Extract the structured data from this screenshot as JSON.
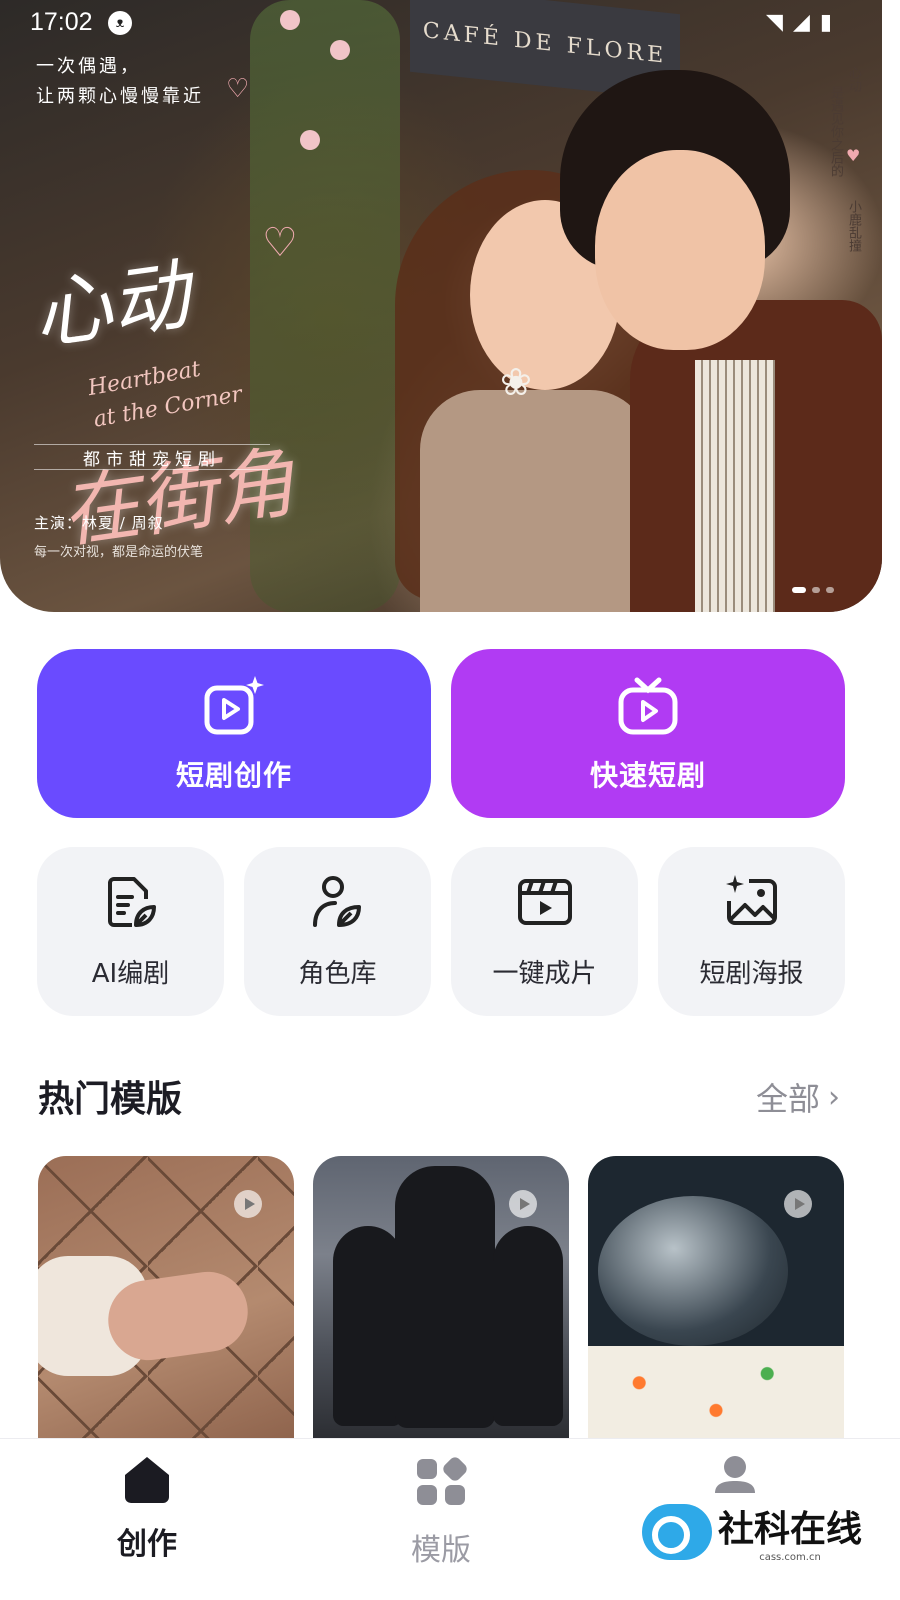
{
  "status_bar": {
    "time": "17:02"
  },
  "banner": {
    "shop_sign": "CAFÉ DE FLORE",
    "tagline": "一次偶遇，\n让两颗心慢慢靠近",
    "title_line1": "心动",
    "title_line2": "在街角",
    "title_en": "Heartbeat\nat the Corner",
    "genre": "都市甜宠短剧",
    "cast": "主演：林夏  /  周叙",
    "quote": "每一次对视，都是命运的伏笔",
    "side_text_1": "心动",
    "side_text_2": "是遇见你之后的",
    "side_text_3": "小鹿乱撞",
    "carousel": {
      "count": 3,
      "active_index": 0
    }
  },
  "primary_actions": [
    {
      "label": "短剧创作",
      "icon": "video-sparkle-icon",
      "color": "#6a4bff"
    },
    {
      "label": "快速短剧",
      "icon": "tv-play-icon",
      "color": "#b13bf3"
    }
  ],
  "tools": [
    {
      "label": "AI编剧",
      "icon": "script-pen-icon"
    },
    {
      "label": "角色库",
      "icon": "person-leaf-icon"
    },
    {
      "label": "一键成片",
      "icon": "clapper-play-icon"
    },
    {
      "label": "短剧海报",
      "icon": "image-sparkle-icon"
    }
  ],
  "hot_templates": {
    "title": "热门模版",
    "see_all": "全部",
    "items": [
      {
        "icon": "play-icon"
      },
      {
        "icon": "play-icon"
      },
      {
        "icon": "play-icon"
      }
    ]
  },
  "tabbar": {
    "tabs": [
      {
        "label": "创作",
        "icon": "home-icon",
        "active": true
      },
      {
        "label": "模版",
        "icon": "grid-icon",
        "active": false
      },
      {
        "label": "",
        "icon": "user-icon",
        "active": false
      }
    ]
  },
  "watermark": {
    "text": "社科在线",
    "sub": "cass.com.cn"
  },
  "colors": {
    "accent_purple": "#6a4bff",
    "accent_violet": "#b13bf3",
    "tile_bg": "#f2f3f6"
  }
}
